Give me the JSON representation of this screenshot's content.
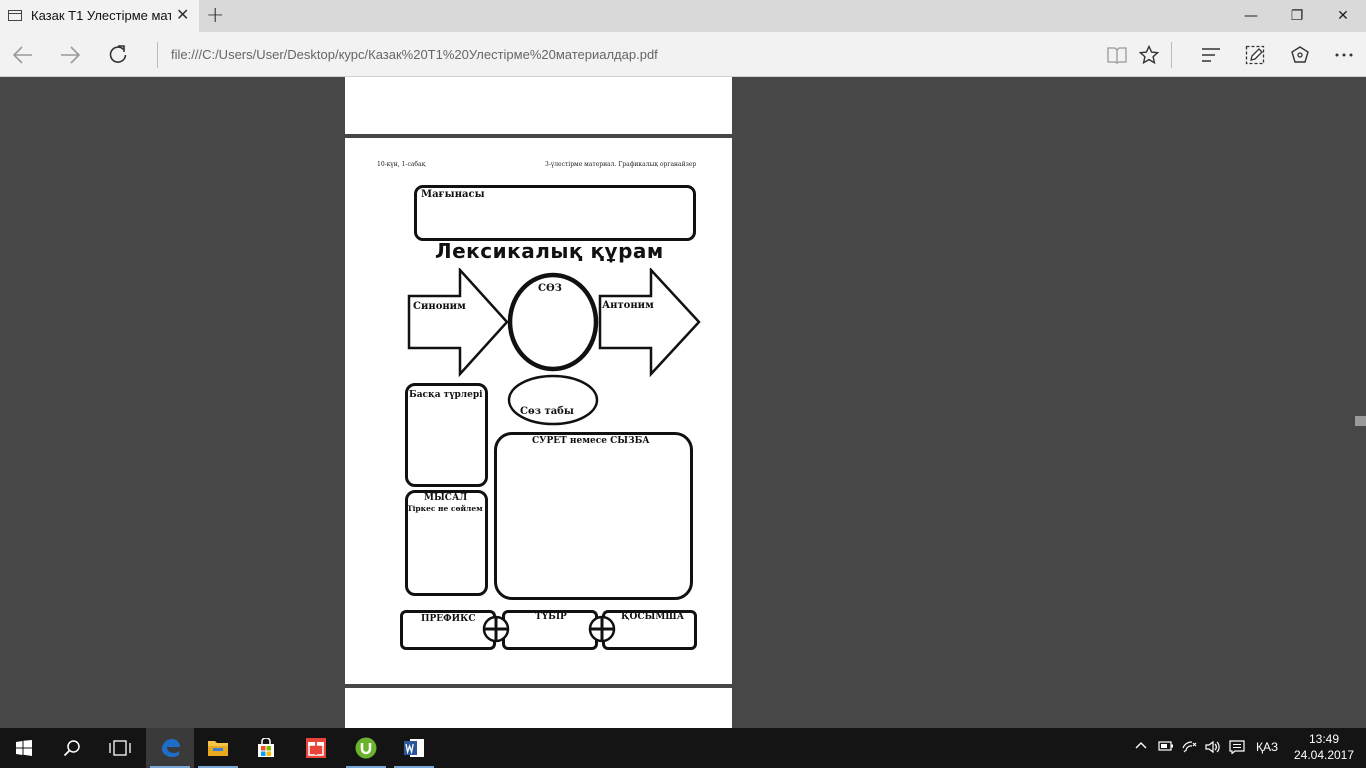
{
  "browser": {
    "tab_title": "Казак Т1 Улестірме мат",
    "tab_close": "✕",
    "new_tab": "+",
    "window_controls": {
      "minimize": "—",
      "maximize": "❐",
      "close": "✕"
    },
    "url": "file:///C:/Users/User/Desktop/курс/Казак%20Т1%20Улестірме%20материалдар.pdf",
    "nav_icons": [
      "back-icon",
      "forward-icon",
      "refresh-icon"
    ],
    "toolbar_icons": [
      "reading-view-icon",
      "favorite-star-icon",
      "hub-icon",
      "web-note-icon",
      "share-icon",
      "more-icon"
    ]
  },
  "document": {
    "header_left": "10-күн, 1-сабақ",
    "header_right": "3-үлестірме материал. Графикалық органайзер",
    "meaning_label": "Мағынасы",
    "title": "Лексикалық құрам",
    "synonym_label": "Синоним",
    "word_label": "СӨЗ",
    "antonym_label": "Антоним",
    "word_class_label": "Сөз табы",
    "other_forms_label": "Басқа түрлері",
    "example_label": "МЫСАЛ",
    "example_sub_label": "Тіркес не сөйлем",
    "picture_label": "СУРЕТ немесе СЫЗБА",
    "prefix_label": "ПРЕФИКС",
    "root_label": "ТҮБІР",
    "suffix_label": "ҚОСЫМША"
  },
  "taskbar": {
    "apps": [
      "windows-start-icon",
      "search-icon",
      "task-view-icon",
      "edge-icon",
      "file-explorer-icon",
      "store-icon",
      "gift-app-icon",
      "utorrent-icon",
      "word-icon"
    ],
    "language": "ҚАЗ",
    "time": "13:49",
    "date": "24.04.2017"
  },
  "colors": {
    "page_bg": "#474747",
    "chrome": "#f2f2f2",
    "tabstrip": "#d9d9d9",
    "taskbar": "#141414",
    "edge_blue": "#1e6ec8"
  }
}
